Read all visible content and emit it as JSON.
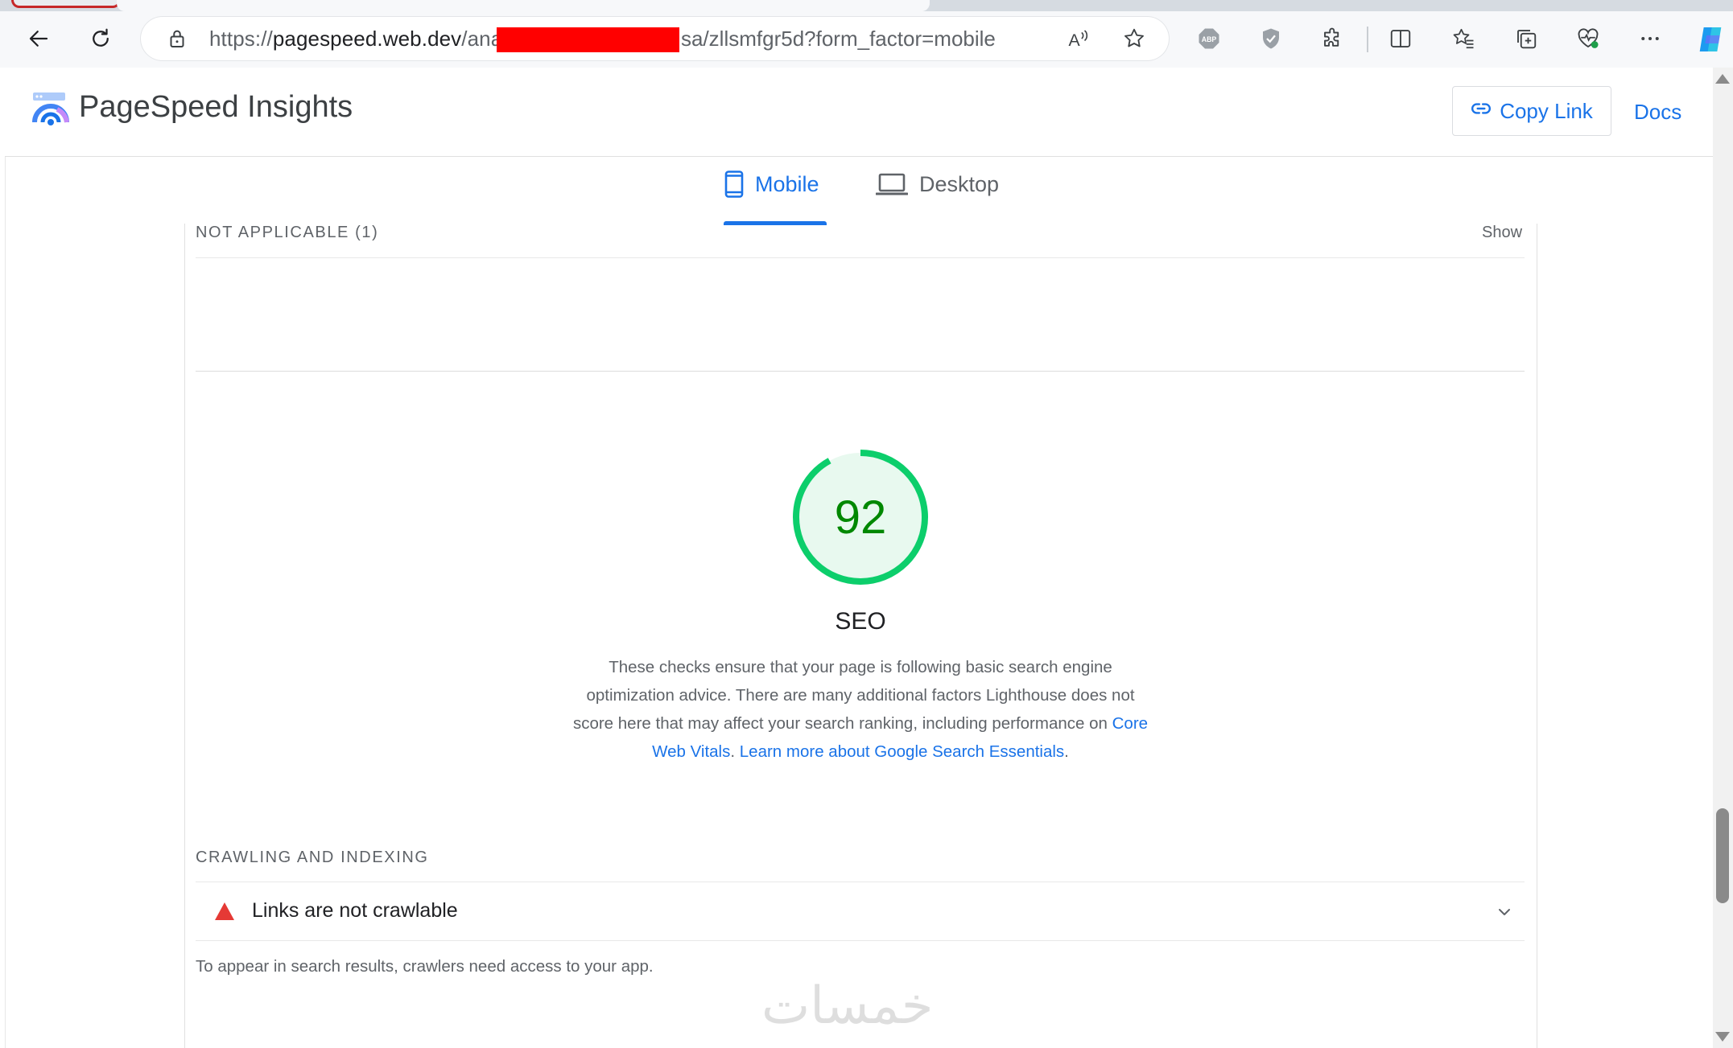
{
  "browser": {
    "url": {
      "scheme": "https://",
      "host": "pagespeed.web.dev",
      "path_start": "/analy",
      "path_end": "sa/zllsmfgr5d?form_factor=mobile"
    },
    "toolbar_icons": [
      "back-icon",
      "refresh-icon",
      "lock-icon",
      "read-aloud-icon",
      "favorite-star-icon",
      "adblock-icon",
      "shield-extension-icon",
      "extensions-icon",
      "split-screen-icon",
      "favorites-icon",
      "collections-icon",
      "browser-essentials-icon",
      "more-icon",
      "copilot-icon"
    ]
  },
  "header": {
    "title": "PageSpeed Insights",
    "copy_link_label": "Copy Link",
    "docs_label": "Docs"
  },
  "tabs": {
    "mobile_label": "Mobile",
    "desktop_label": "Desktop",
    "active": "Mobile"
  },
  "not_applicable": {
    "label": "NOT APPLICABLE (1)",
    "toggle_label": "Show"
  },
  "seo": {
    "score": "92",
    "score_fraction": 0.92,
    "title": "SEO",
    "description": "These checks ensure that your page is following basic search engine optimization advice. There are many additional factors Lighthouse does not score here that may affect your search ranking, including performance on",
    "link_core_web_vitals": "Core Web Vitals",
    "link_learn_more": "Learn more about Google Search Essentials",
    "pass_color": "#0cce6b"
  },
  "crawling": {
    "section_label": "CRAWLING AND INDEXING",
    "audit_title": "Links are not crawlable",
    "audit_status": "fail",
    "description": "To appear in search results, crawlers need access to your app."
  },
  "watermark": "خمسات",
  "colors": {
    "accent": "#1a73e8",
    "fail": "#e53935",
    "pass_text": "#008800"
  }
}
